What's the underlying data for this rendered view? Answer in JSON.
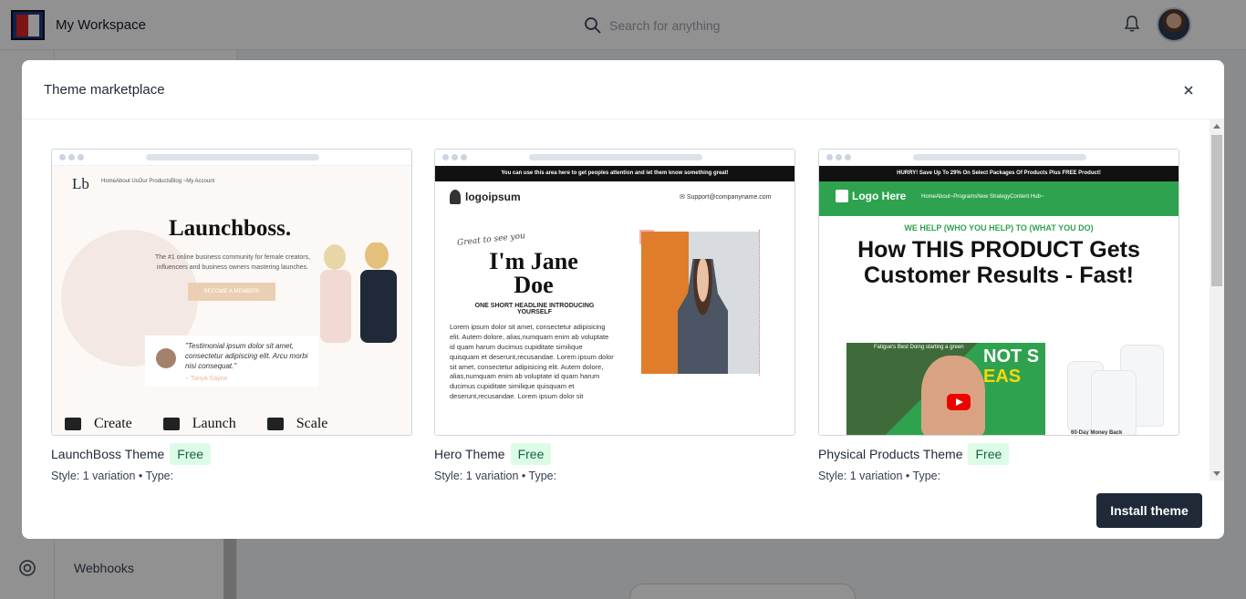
{
  "app": {
    "workspace": "My Workspace",
    "search_placeholder": "Search for anything",
    "subnav_item": "Webhooks"
  },
  "modal": {
    "title": "Theme marketplace",
    "install_label": "Install theme"
  },
  "themes": [
    {
      "name": "LaunchBoss Theme",
      "badge": "Free",
      "meta": "Style: 1 variation • Type:",
      "preview": {
        "logo": "Lb",
        "nav": "HomeAbout UsOur ProductsBlog ~My Account",
        "headline": "Launchboss.",
        "sub": "The #1 online business community for female creators, influencers and business owners mastering launches.",
        "cta": "BECOME A MEMBER!",
        "quote": "\"Testimonial ipsum dolor sit amet, consectetur adipiscing elit. Arcu morbi nisi consequat.\"",
        "quote_by": "~ Tanya Sayne",
        "features": [
          "Create",
          "Launch",
          "Scale"
        ]
      }
    },
    {
      "name": "Hero Theme",
      "badge": "Free",
      "meta": "Style: 1 variation • Type:",
      "preview": {
        "strip": "You can use this area here to get peoples attention and let them know something great!",
        "brand": "logoipsum",
        "email": "Support@companyname.com",
        "script": "Great to see you",
        "name": "I'm Jane Doe",
        "subhead": "ONE SHORT HEADLINE INTRODUCING YOURSELF",
        "body": "Lorem ipsum dolor sit amet, consectetur adipisicing elit. Autem dolore, alias,numquam enim ab voluptate id quam harum ducimus cupiditate similique quisquam et deserunt,recusandae. Lorem ipsum dolor sit amet, consectetur adipisicing elit. Autem dolore, alias,numquam enim ab voluptate id quam harum ducimus cupiditate similique quisquam et deserunt,recusandae. Lorem ipsum dolor sit"
      }
    },
    {
      "name": "Physical Products Theme",
      "badge": "Free",
      "meta": "Style: 1 variation • Type:",
      "preview": {
        "strip": "HURRY! Save Up To 29% On Select Packages Of Products Plus FREE Product!",
        "brand": "Logo Here",
        "nav": "HomeAbout~ProgramsNew StrategyContent Hub~",
        "tagline": "WE HELP (WHO YOU HELP) TO (WHAT YOU DO)",
        "headline": "How THIS PRODUCT Gets Customer Results - Fast!",
        "video_title": "Fatigue's Best Doing starting a green",
        "video_text_1": "NOT S",
        "video_text_2": "EAS",
        "money_back": "60-Day Money Back"
      }
    }
  ]
}
